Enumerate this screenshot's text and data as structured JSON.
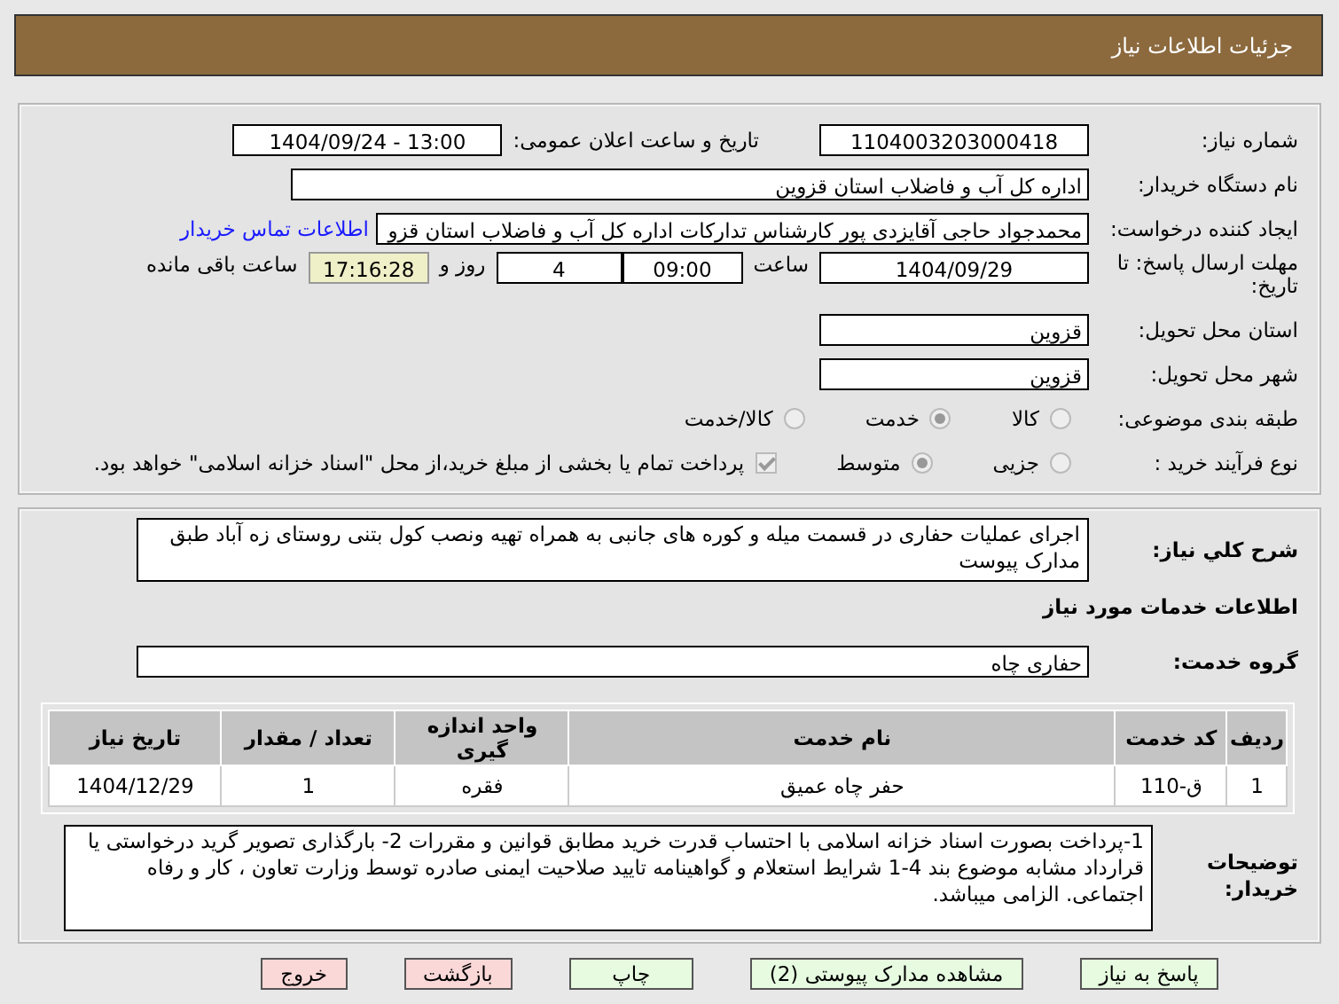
{
  "header": {
    "title": "جزئیات اطلاعات نیاز"
  },
  "details": {
    "need_number": {
      "label": "شماره نیاز:",
      "value": "1104003203000418"
    },
    "announce": {
      "label": "تاریخ و ساعت اعلان عمومی:",
      "value": "13:00 - 1404/09/24"
    },
    "buyer": {
      "label": "نام دستگاه خریدار:",
      "value": "اداره کل آب و فاضلاب استان قزوین"
    },
    "creator": {
      "label": "ایجاد کننده درخواست:",
      "value": "محمدجواد حاجی آقایزدی پور کارشناس تدارکات اداره کل آب و فاضلاب استان قزو",
      "link": "اطلاعات تماس خریدار"
    },
    "deadline": {
      "label": "مهلت ارسال پاسخ: تا تاریخ:",
      "date": "1404/09/29",
      "time_label": "ساعت",
      "time": "09:00",
      "days": "4",
      "days_label": "روز و",
      "remaining": "17:16:28",
      "remaining_label": "ساعت باقی مانده"
    },
    "province": {
      "label": "استان محل تحویل:",
      "value": "قزوین"
    },
    "city": {
      "label": "شهر محل تحویل:",
      "value": "قزوین"
    },
    "category": {
      "label": "طبقه بندی موضوعی:",
      "options": [
        {
          "label": "کالا",
          "selected": false
        },
        {
          "label": "خدمت",
          "selected": true
        },
        {
          "label": "کالا/خدمت",
          "selected": false
        }
      ]
    },
    "process": {
      "label": "نوع فرآیند خرید :",
      "options": [
        {
          "label": "جزیی",
          "selected": false
        },
        {
          "label": "متوسط",
          "selected": true
        }
      ],
      "treasury": {
        "checked": true,
        "text": "پرداخت تمام یا بخشی از مبلغ خرید،از محل \"اسناد خزانه اسلامی\" خواهد بود."
      }
    }
  },
  "need": {
    "description": {
      "label": "شرح کلي نياز:",
      "value": "اجرای عملیات حفاری در قسمت میله و کوره  های جانبی به همراه تهیه ونصب کول بتنی روستای زه آباد طبق مدارک پیوست"
    },
    "services_heading": "اطلاعات خدمات مورد نیاز",
    "service_group": {
      "label": "گروه خدمت:",
      "value": "حفاری چاه"
    },
    "table": {
      "columns": [
        "ردیف",
        "کد خدمت",
        "نام خدمت",
        "واحد اندازه گیری",
        "تعداد / مقدار",
        "تاریخ نیاز"
      ],
      "rows": [
        [
          "1",
          "ق-110",
          "حفر چاه عمیق",
          "فقره",
          "1",
          "1404/12/29"
        ]
      ]
    },
    "buyer_notes": {
      "label": "توضیحات خریدار:",
      "value": "1-پرداخت بصورت اسناد خزانه اسلامی با احتساب قدرت خرید مطابق قوانین و مقررات 2- بارگذاری تصویر گرید درخواستی یا قرارداد مشابه موضوع بند 4-1 شرایط استعلام و گواهینامه تایید صلاحیت ایمنی صادره توسط وزارت تعاون ، کار و رفاه اجتماعی. الزامی میباشد."
    }
  },
  "buttons": [
    {
      "label": "پاسخ به نیاز",
      "kind": "primary"
    },
    {
      "label": "مشاهده مدارک پیوستی (2)",
      "kind": "primary"
    },
    {
      "label": "چاپ",
      "kind": "primary"
    },
    {
      "label": "بازگشت",
      "kind": "danger"
    },
    {
      "label": "خروج",
      "kind": "danger"
    }
  ]
}
